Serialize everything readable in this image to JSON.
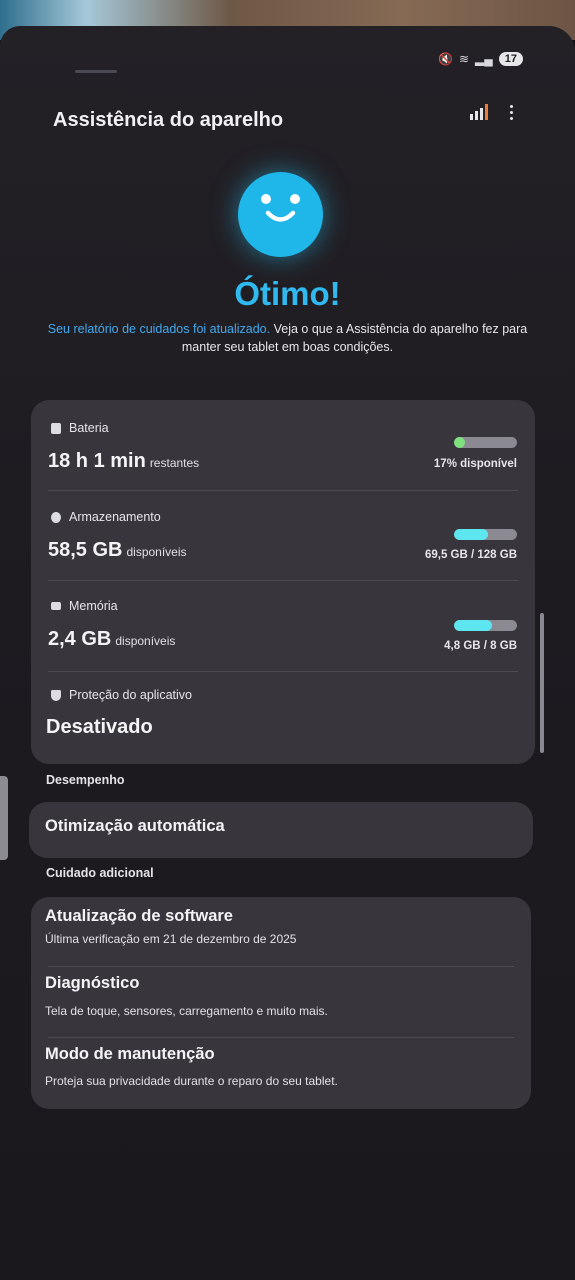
{
  "status_bar": {
    "battery_level": "17"
  },
  "header": {
    "title": "Assistência do aparelho",
    "stats_icon": "bar-chart-icon",
    "menu_icon": "more-vert-icon"
  },
  "summary": {
    "status": "Ótimo!",
    "report_link": "Seu relatório de cuidados foi atualizado.",
    "report_text": "Veja o que a Assistência do aparelho fez para manter seu tablet em boas condições."
  },
  "battery": {
    "label": "Bateria",
    "value": "18 h 1 min",
    "suffix": "restantes",
    "level_percent": 17,
    "level_text": "17% disponível",
    "bar_color": "#7ee07e"
  },
  "storage": {
    "label": "Armazenamento",
    "value": "58,5 GB",
    "suffix": "disponíveis",
    "used_fraction": 0.54,
    "usage_text": "69,5 GB / 128 GB",
    "bar_color": "#5ee6f0"
  },
  "memory": {
    "label": "Memória",
    "value": "2,4 GB",
    "suffix": "disponíveis",
    "used_fraction": 0.6,
    "usage_text": "4,8 GB / 8 GB",
    "bar_color": "#5ee6f0"
  },
  "app_protection": {
    "label": "Proteção do aplicativo",
    "value": "Desativado"
  },
  "performance": {
    "section": "Desempenho",
    "auto_optimization": "Otimização automática"
  },
  "additional_care": {
    "section": "Cuidado adicional",
    "items": [
      {
        "title": "Atualização de software",
        "subtitle": "Última verificação em 21 de dezembro de 2025"
      },
      {
        "title": "Diagnóstico",
        "subtitle": "Tela de toque, sensores, carregamento e muito mais."
      },
      {
        "title": "Modo de manutenção",
        "subtitle": "Proteja sua privacidade durante o reparo do seu tablet."
      }
    ]
  }
}
